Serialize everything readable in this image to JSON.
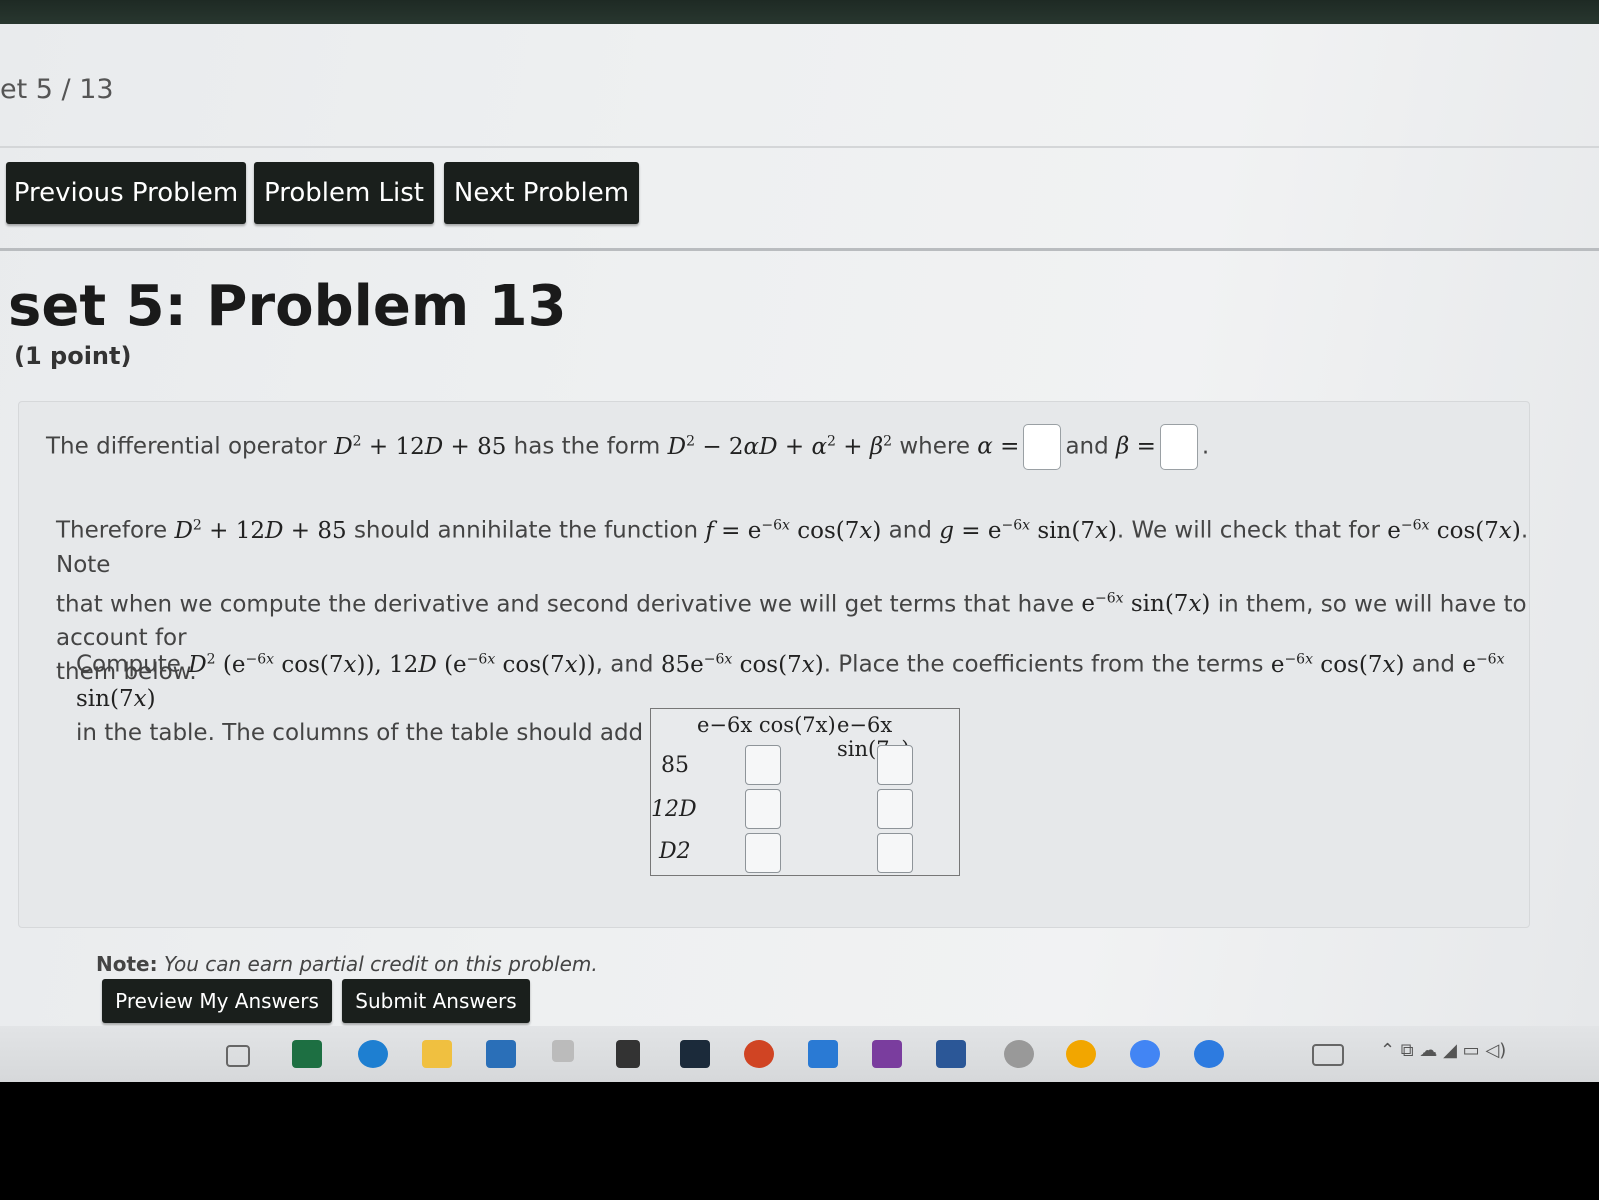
{
  "breadcrumb": "et 5 / 13",
  "nav": {
    "previous": "Previous Problem",
    "list": "Problem List",
    "next": "Next Problem"
  },
  "problem": {
    "title": "set 5: Problem 13",
    "points": "(1 point)",
    "para1": {
      "t1": "The differential operator ",
      "t2": " has the form ",
      "t3": " where ",
      "t4": "and "
    },
    "para2": {
      "t1": "Therefore ",
      "t2": " should annihilate the function ",
      "t3": " and ",
      "t4": ". We will check that for ",
      "t5": ". Note",
      "line2a": "that when we compute the derivative and second derivative we will get terms that have ",
      "line2b": " in them, so we will have to account for",
      "line3": "them below."
    },
    "para3": {
      "t1": "Compute ",
      "t2": ", and ",
      "t3": ". Place the coefficients from the terms ",
      "t4": " and ",
      "line2": "in the table. The columns of the table should add to zero."
    },
    "table": {
      "col1": "e−6x cos(7x)",
      "col2": "e−6x sin(7x)",
      "rows": [
        "85",
        "12D",
        "D2"
      ]
    },
    "note_label": "Note:",
    "note_text": "You can earn partial credit on this problem."
  },
  "buttons": {
    "preview": "Preview My Answers",
    "submit": "Submit Answers"
  },
  "taskbar": {
    "icons": [
      "task-view-icon",
      "excel-icon",
      "edge-icon",
      "file-explorer-icon",
      "store-icon",
      "app-icon",
      "dropbox-icon",
      "app-s-icon",
      "powerpoint-icon",
      "mail-icon",
      "onenote-icon",
      "word-icon",
      "snip-icon",
      "app-circle-icon",
      "chrome-icon",
      "help-icon"
    ]
  }
}
